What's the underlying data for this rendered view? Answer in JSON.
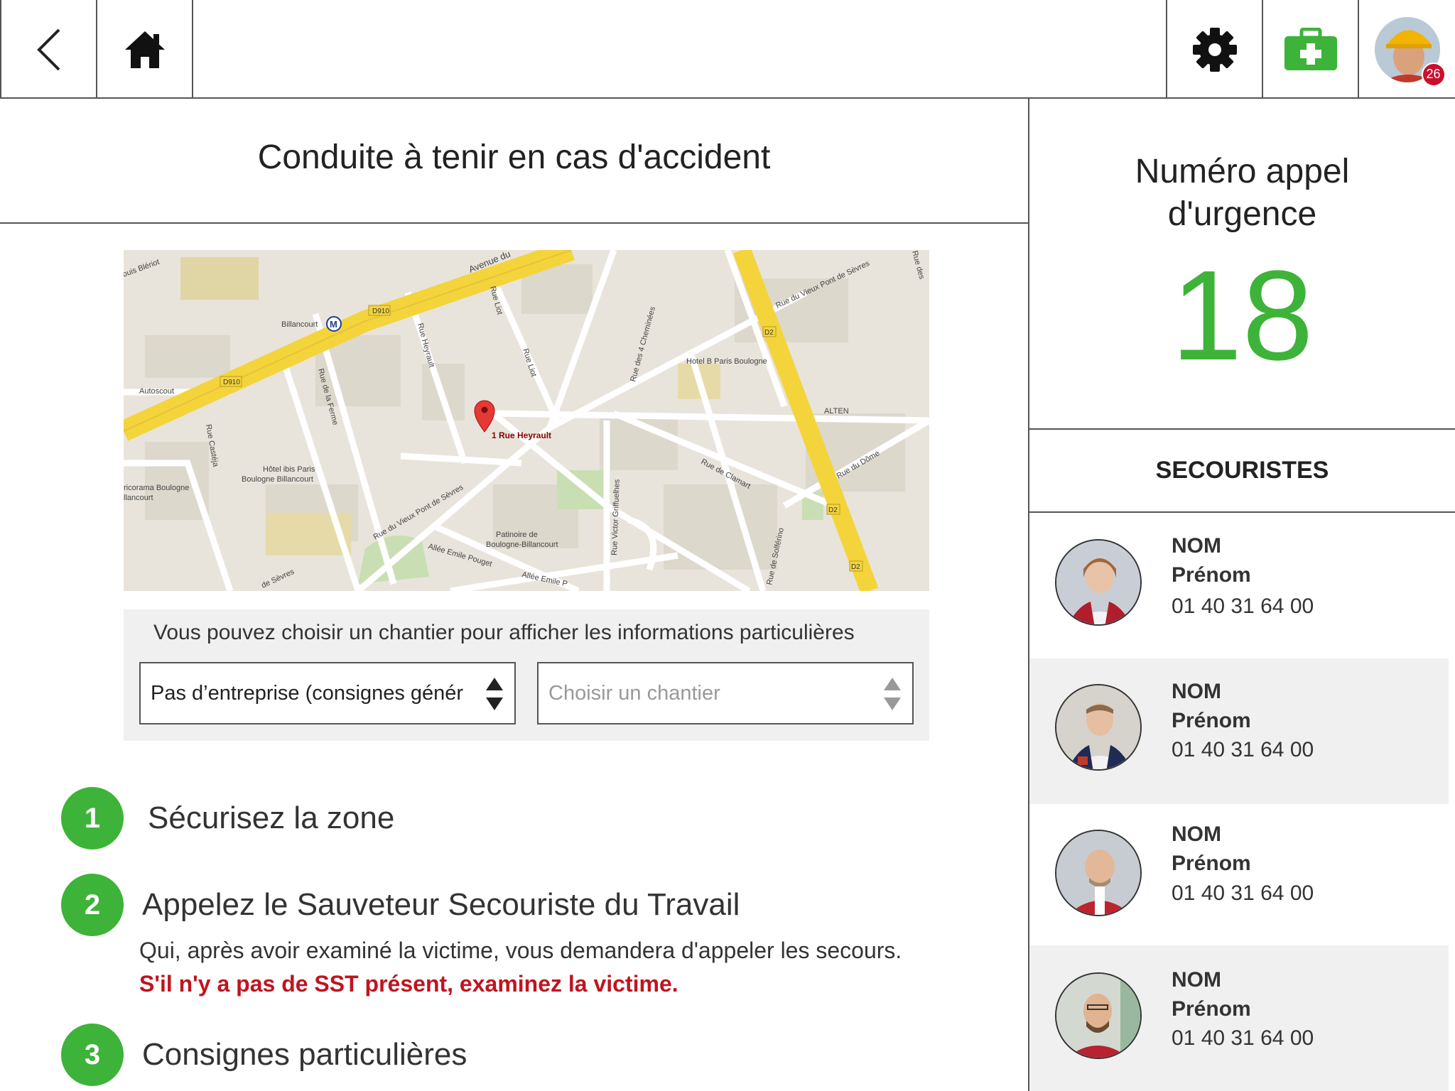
{
  "topbar": {
    "back_icon": "chevron-left-icon",
    "home_icon": "home-icon",
    "settings_icon": "gear-icon",
    "first_aid_icon": "first-aid-kit-icon",
    "notification_count": "26",
    "accent_green": "#3db33a",
    "badge_red": "#c8102e"
  },
  "page": {
    "title": "Conduite à tenir en cas d'accident"
  },
  "map": {
    "labels": {
      "billancourt": "Billancourt",
      "avenue": "Avenue du",
      "d910_a": "D910",
      "d910_b": "D910",
      "rue_liot": "Rue Liot",
      "rue_liot2": "Rue Liot",
      "rue_heyrault": "Rue Heyrault",
      "rue_ferme": "Rue de la Ferme",
      "rue_casteja": "Rue Castéja",
      "autoscout": "Autoscout",
      "hotel_ibis_1": "Hôtel ibis Paris",
      "hotel_ibis_2": "Boulogne Billancourt",
      "pin_label": "1 Rue Heyrault",
      "hotel_b": "Hotel B Paris Boulogne",
      "alten": "ALTEN",
      "rue_4_cheminees": "Rue des 4 Cheminées",
      "rue_vieux_pont_1": "Rue du Vieux Pont de Sèvres",
      "rue_vieux_pont_2": "Rue du Vieux Pont de Sèvres",
      "rue_clamart": "Rue de Clamart",
      "rue_dome": "Rue du Dôme",
      "d2_a": "D2",
      "d2_b": "D2",
      "d2_c": "D2",
      "patinoire_1": "Patinoire de",
      "patinoire_2": "Boulogne-Billancourt",
      "rue_griffuelhes": "Rue Victor Griffuelhes",
      "allee_pouget_1": "Allée Emile Pouget",
      "allee_pouget_2": "Allée Emile P",
      "rue_solferino": "Rue de Solférino",
      "ricorama_1": "ricorama Boulogne",
      "ricorama_2": "llancourt",
      "louis_bleriot": "ouis Blériot",
      "de_sevres": "de Sèvres",
      "rue_des": "Rue des"
    }
  },
  "filter": {
    "hint": "Vous pouvez choisir un chantier pour afficher les informations particulières",
    "company_value": "Pas d’entreprise (consignes générales)",
    "site_placeholder": "Choisir un chantier"
  },
  "steps": [
    {
      "number": "1",
      "label": "Sécurisez la zone"
    },
    {
      "number": "2",
      "label": "Appelez le Sauveteur Secouriste du Travail",
      "description": "Qui, après avoir examiné la victime, vous demandera d'appeler les secours.",
      "warning": "S'il n'y a pas de SST présent, examinez la victime."
    },
    {
      "number": "3",
      "label": "Consignes particulières"
    }
  ],
  "emergency": {
    "title_line1": "Numéro appel",
    "title_line2": "d'urgence",
    "number": "18"
  },
  "rescuers": {
    "title": "SECOURISTES",
    "items": [
      {
        "name": "NOM",
        "first_name": "Prénom",
        "phone": "01 40 31 64 00"
      },
      {
        "name": "NOM",
        "first_name": "Prénom",
        "phone": "01 40 31 64 00"
      },
      {
        "name": "NOM",
        "first_name": "Prénom",
        "phone": "01 40 31 64 00"
      },
      {
        "name": "NOM",
        "first_name": "Prénom",
        "phone": "01 40 31 64 00"
      }
    ]
  }
}
